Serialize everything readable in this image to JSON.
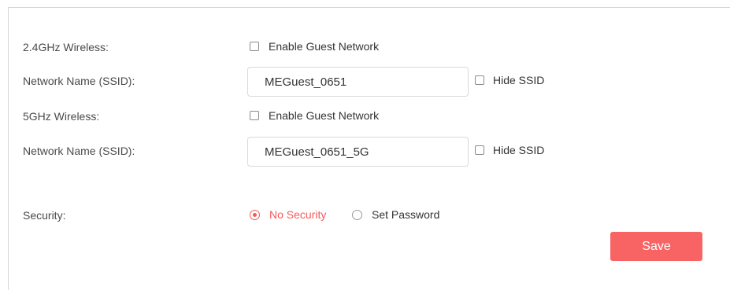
{
  "wireless_24": {
    "label": "2.4GHz Wireless:",
    "enable_guest_label": "Enable Guest Network",
    "enable_guest_checked": false,
    "ssid_label": "Network Name (SSID):",
    "ssid_value": "MEGuest_0651",
    "hide_ssid_label": "Hide SSID",
    "hide_ssid_checked": false
  },
  "wireless_5": {
    "label": "5GHz Wireless:",
    "enable_guest_label": "Enable Guest Network",
    "enable_guest_checked": false,
    "ssid_label": "Network Name (SSID):",
    "ssid_value": "MEGuest_0651_5G",
    "hide_ssid_label": "Hide SSID",
    "hide_ssid_checked": false
  },
  "security": {
    "label": "Security:",
    "options": [
      {
        "label": "No Security",
        "selected": true
      },
      {
        "label": "Set Password",
        "selected": false
      }
    ]
  },
  "actions": {
    "save_label": "Save"
  },
  "colors": {
    "accent": "#f86464",
    "selected_text": "#f25c5c",
    "label_text": "#4a4a4a",
    "border": "#d9d9d9"
  }
}
